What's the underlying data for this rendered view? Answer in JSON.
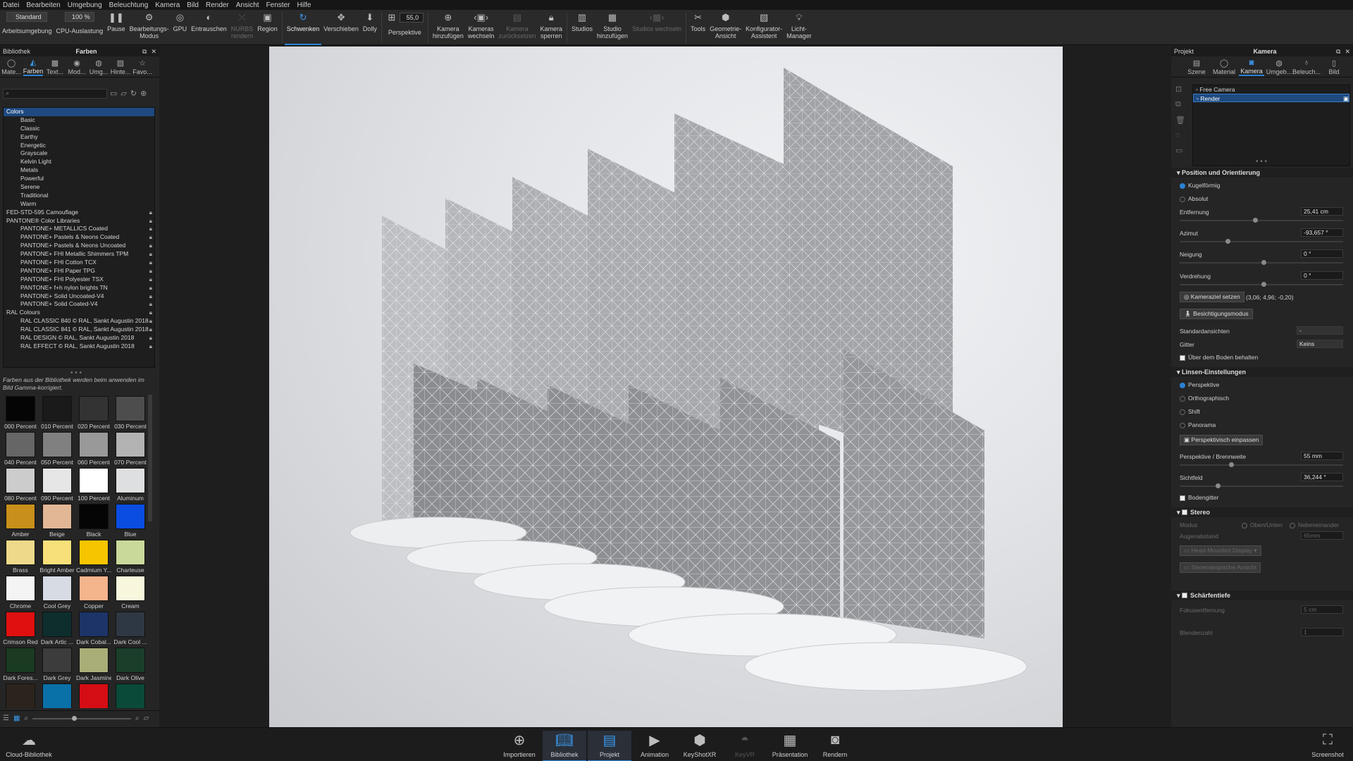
{
  "menubar": [
    "Datei",
    "Bearbeiten",
    "Umgebung",
    "Beleuchtung",
    "Kamera",
    "Bild",
    "Render",
    "Ansicht",
    "Fenster",
    "Hilfe"
  ],
  "toolbar": {
    "workspace_value": "Standard",
    "workspace_label": "Arbeitsumgebung",
    "cpu_value": "100 %",
    "cpu_label": "CPU-Auslastung",
    "pause": "Pause",
    "edit_mode": "Bearbeitungs-\nModus",
    "gpu": "GPU",
    "denoise": "Entrauschen",
    "nurbs": "NURBS\nrendern",
    "region": "Region",
    "pan": "Schwenken",
    "move": "Verschieben",
    "dolly": "Dolly",
    "perspective_value": "55,0",
    "perspective": "Perspektive",
    "add_camera": "Kamera\nhinzufügen",
    "switch_cameras": "Kameras\nwechseln",
    "reset_camera": "Kamera\nzurücksetzen",
    "lock_camera": "Kamera\nsperren",
    "studios": "Studios",
    "add_studio": "Studio\nhinzufügen",
    "switch_studios": "Studios wechseln",
    "tools": "Tools",
    "geometry_view": "Geometrie-\nAnsicht",
    "configurator": "Konfigurator-\nAssistent",
    "light_manager": "Licht-\nManager"
  },
  "library": {
    "panel_title": "Bibliothek",
    "header_title": "Farben",
    "tabs": [
      "Mate...",
      "Farben",
      "Text...",
      "Mod...",
      "Umg...",
      "Hinte...",
      "Favo..."
    ],
    "tree": [
      {
        "label": "Colors",
        "indent": 1,
        "selected": true,
        "lock": false
      },
      {
        "label": "Basic",
        "indent": 2,
        "lock": false
      },
      {
        "label": "Classic",
        "indent": 2,
        "lock": false
      },
      {
        "label": "Earthy",
        "indent": 2,
        "lock": false
      },
      {
        "label": "Energetic",
        "indent": 2,
        "lock": false
      },
      {
        "label": "Grayscale",
        "indent": 2,
        "lock": false
      },
      {
        "label": "Kelvin Light",
        "indent": 2,
        "lock": false
      },
      {
        "label": "Metals",
        "indent": 2,
        "lock": false
      },
      {
        "label": "Powerful",
        "indent": 2,
        "lock": false
      },
      {
        "label": "Serene",
        "indent": 2,
        "lock": false
      },
      {
        "label": "Traditional",
        "indent": 2,
        "lock": false
      },
      {
        "label": "Warm",
        "indent": 2,
        "lock": false
      },
      {
        "label": "FED-STD-595 Camouflage",
        "indent": 1,
        "lock": true
      },
      {
        "label": "PANTONE® Color Libraries",
        "indent": 1,
        "lock": true
      },
      {
        "label": "PANTONE+ METALLICS Coated",
        "indent": 2,
        "lock": true
      },
      {
        "label": "PANTONE+ Pastels & Neons Coated",
        "indent": 2,
        "lock": true
      },
      {
        "label": "PANTONE+ Pastels & Neons Uncoated",
        "indent": 2,
        "lock": true
      },
      {
        "label": "PANTONE+ FHI Metallic Shimmers TPM",
        "indent": 2,
        "lock": true
      },
      {
        "label": "PANTONE+ FHI Cotton TCX",
        "indent": 2,
        "lock": true
      },
      {
        "label": "PANTONE+ FHI Paper TPG",
        "indent": 2,
        "lock": true
      },
      {
        "label": "PANTONE+ FHI Polyester TSX",
        "indent": 2,
        "lock": true
      },
      {
        "label": "PANTONE+ f+h nylon brights TN",
        "indent": 2,
        "lock": true
      },
      {
        "label": "PANTONE+ Solid Uncoated-V4",
        "indent": 2,
        "lock": true
      },
      {
        "label": "PANTONE+ Solid Coated-V4",
        "indent": 2,
        "lock": true
      },
      {
        "label": "RAL Colours",
        "indent": 1,
        "lock": true
      },
      {
        "label": "RAL CLASSIC 840 © RAL, Sankt Augustin 2018",
        "indent": 2,
        "lock": true
      },
      {
        "label": "RAL CLASSIC 841 © RAL, Sankt Augustin 2018",
        "indent": 2,
        "lock": true
      },
      {
        "label": "RAL DESIGN © RAL, Sankt Augustin 2018",
        "indent": 2,
        "lock": true
      },
      {
        "label": "RAL EFFECT © RAL, Sankt Augustin 2018",
        "indent": 2,
        "lock": true
      }
    ],
    "note": "Farben aus der Bibliothek werden beim anwenden im Bild Gamma-korrigiert.",
    "swatches": [
      {
        "name": "000 Percent",
        "color": "#050505"
      },
      {
        "name": "010 Percent",
        "color": "#1a1a1a"
      },
      {
        "name": "020 Percent",
        "color": "#333333"
      },
      {
        "name": "030 Percent",
        "color": "#4d4d4d"
      },
      {
        "name": "040 Percent",
        "color": "#666666"
      },
      {
        "name": "050 Percent",
        "color": "#808080"
      },
      {
        "name": "060 Percent",
        "color": "#999999"
      },
      {
        "name": "070 Percent",
        "color": "#b3b3b3"
      },
      {
        "name": "080 Percent",
        "color": "#cccccc"
      },
      {
        "name": "090 Percent",
        "color": "#e6e6e6"
      },
      {
        "name": "100 Percent",
        "color": "#ffffff"
      },
      {
        "name": "Aluminum",
        "color": "#dedfe0"
      },
      {
        "name": "Amber",
        "color": "#c8901a"
      },
      {
        "name": "Beige",
        "color": "#e2b796"
      },
      {
        "name": "Black",
        "color": "#050505"
      },
      {
        "name": "Blue",
        "color": "#0a4de0"
      },
      {
        "name": "Brass",
        "color": "#eed98a"
      },
      {
        "name": "Bright Amber",
        "color": "#f7e07a"
      },
      {
        "name": "Cadmium Y...",
        "color": "#f7c500"
      },
      {
        "name": "Charteuse",
        "color": "#c9d99a"
      },
      {
        "name": "Chrome",
        "color": "#f4f4f4"
      },
      {
        "name": "Cool Grey",
        "color": "#d7dbe3"
      },
      {
        "name": "Copper",
        "color": "#f4b48c"
      },
      {
        "name": "Cream",
        "color": "#f8f6dc"
      },
      {
        "name": "Crimson Red",
        "color": "#e01010"
      },
      {
        "name": "Dark Artic ...",
        "color": "#0e2e2e"
      },
      {
        "name": "Dark Cobal...",
        "color": "#1c3468"
      },
      {
        "name": "Dark Cool ...",
        "color": "#2e3844"
      },
      {
        "name": "Dark Fores...",
        "color": "#1a3a22"
      },
      {
        "name": "Dark Grey",
        "color": "#3c3c3c"
      },
      {
        "name": "Dark Jasmine",
        "color": "#a9ae78"
      },
      {
        "name": "Dark Olive",
        "color": "#1a3e2a"
      },
      {
        "name": "",
        "color": "#2c241c"
      },
      {
        "name": "",
        "color": "#0a70a8"
      },
      {
        "name": "",
        "color": "#d40e14"
      },
      {
        "name": "",
        "color": "#0a4a38"
      }
    ]
  },
  "project": {
    "panel_title": "Projekt",
    "header_title": "Kamera",
    "tabs": [
      "Szene",
      "Material",
      "Kamera",
      "Umgeb...",
      "Beleuch...",
      "Bild"
    ],
    "cameras": [
      "Free Camera",
      "Render"
    ],
    "section_position": "Position und Orientierung",
    "spherical": "Kugelförmig",
    "absolute": "Absolut",
    "distance_label": "Entfernung",
    "distance_value": "25,41 cm",
    "distance_level": 0.45,
    "azimuth_label": "Azimut",
    "azimuth_value": "-93,657 °",
    "azimuth_level": 0.28,
    "inclination_label": "Neigung",
    "inclination_value": "0 °",
    "inclination_level": 0.5,
    "twist_label": "Verdrehung",
    "twist_value": "0 °",
    "twist_level": 0.5,
    "set_target_btn": "Kameraziel setzen",
    "target_coords": "(3,06; 4,96; -0,20)",
    "walkthrough_btn": "Besichtigungsmodus",
    "standard_views_label": "Standardansichten",
    "standard_views_value": "-",
    "grid_label": "Gitter",
    "grid_value": "Keins",
    "stay_above_ground": "Über dem Boden behalten",
    "section_lens": "Linsen-Einstellungen",
    "lens_perspective": "Perspektive",
    "lens_ortho": "Orthographisch",
    "lens_shift": "Shift",
    "lens_panorama": "Panorama",
    "fit_perspective_btn": "Perspektivisch einpassen",
    "focal_label": "Perspektive / Brennweite",
    "focal_value": "55 mm",
    "focal_level": 0.3,
    "fov_label": "Sichtfeld",
    "fov_value": "36,244 °",
    "fov_level": 0.22,
    "ground_grid": "Bodengitter",
    "section_stereo": "Stereo",
    "mode_label": "Modus",
    "mode_top_bottom": "Oben/Unten",
    "mode_side_by_side": "Nebeneinander",
    "eye_distance_label": "Augenabstand",
    "eye_distance_value": "65mm",
    "hmd_btn": "Head-Mounted Display",
    "stereo_view_btn": "Stereoskopische Ansicht",
    "section_dof": "Schärfentiefe",
    "focus_distance_label": "Fokusentfernung",
    "focus_distance_value": "5 cm",
    "aperture_label": "Blendenzahl",
    "aperture_value": "1"
  },
  "bottombar": {
    "cloud_library": "Cloud-Bibliothek",
    "items": [
      "Importieren",
      "Bibliothek",
      "Projekt",
      "Animation",
      "KeyShotXR",
      "KeyVR",
      "Präsentation",
      "Rendern"
    ],
    "screenshot": "Screenshot"
  },
  "colors": {
    "accent": "#2a82d4",
    "selection": "#1e4a80"
  }
}
